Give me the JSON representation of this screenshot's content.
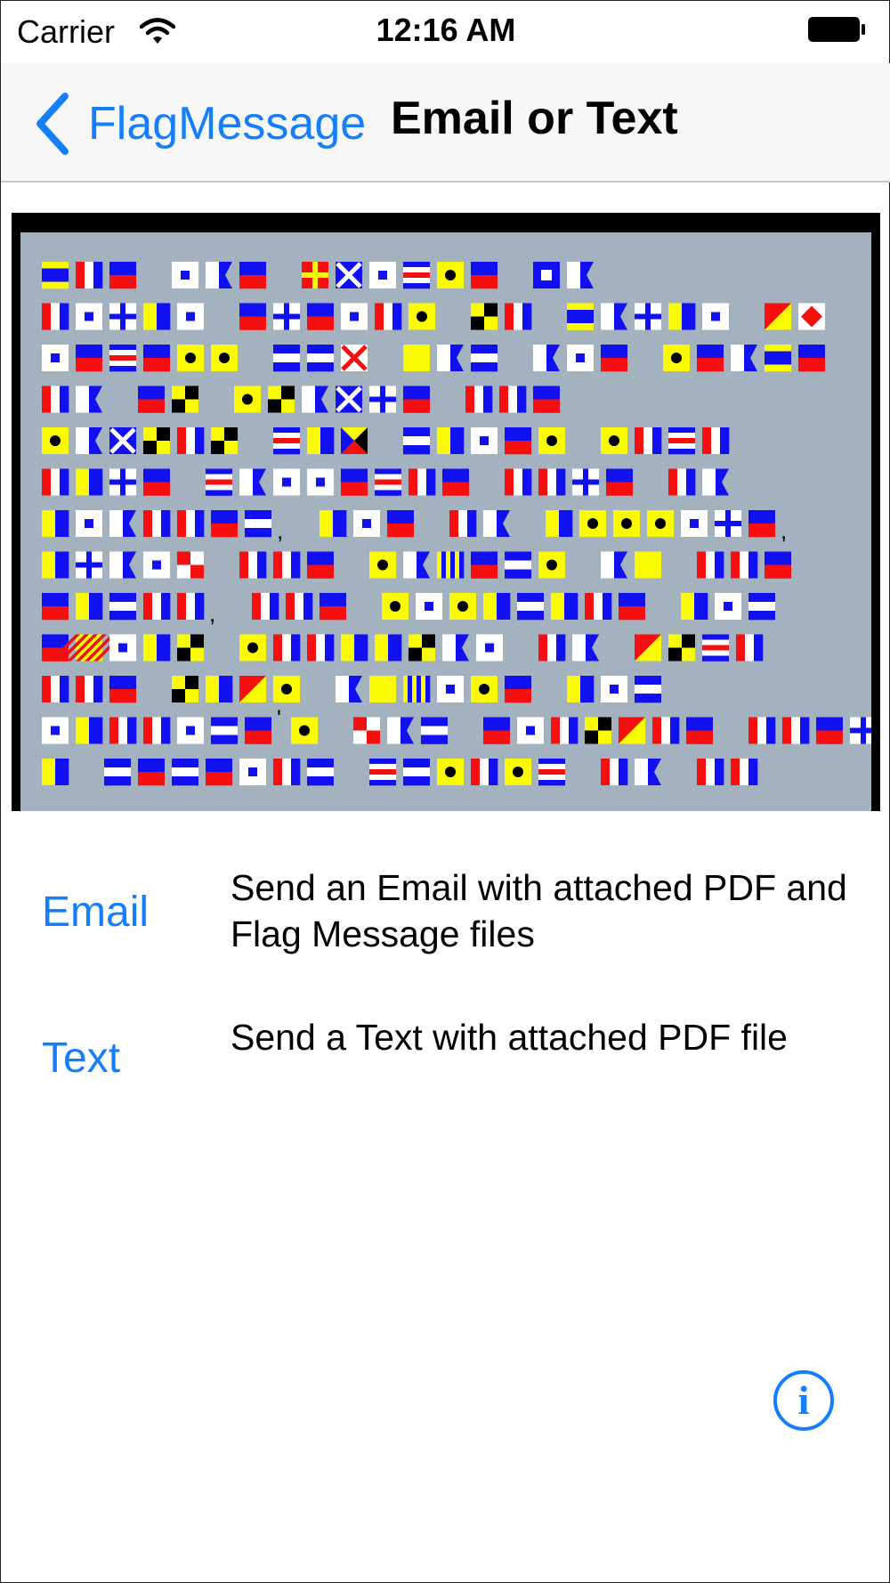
{
  "status_bar": {
    "carrier": "Carrier",
    "time": "12:16 AM"
  },
  "nav": {
    "back_label": "FlagMessage",
    "title": "Email or Text"
  },
  "flag_message": {
    "background": "#a4b2c0",
    "lines": [
      "DTE SAE RMSCIE PA",
      "TSXKS EXESTI LT DAXKS OF",
      "SECEII JJV QAJ ASE IEADE",
      "TA EL ILAMXE TTE",
      "IAMLTL CKZ JKSEI ITCT",
      "TKXE CASSECTE TTXE TA",
      "KSATTEJ, KSE TA KIIISXE,",
      "KXASU TTE IAGEJI AQ TTE",
      "EKJTT, TTE ISIKJKTE KSJ",
      "EYSKL ITTKKLAS TA OLCT",
      "TTE LKOI AQGSIE KSJ",
      "SKTTSJE'I UAJ ESTLOTE TTEX",
      "K JEJESTJ CJITIC TA TT"
    ],
    "colors": {
      "red": "#f50f0f",
      "blue": "#1010f0",
      "yellow": "#fafa05",
      "white": "#ffffff",
      "black": "#000000"
    }
  },
  "options": [
    {
      "label": "Email",
      "description": "Send an Email with attached PDF and Flag Message files"
    },
    {
      "label": "Text",
      "description": "Send a Text with attached PDF file"
    }
  ],
  "info_button": {
    "glyph": "i"
  },
  "accent_color": "#157efb"
}
